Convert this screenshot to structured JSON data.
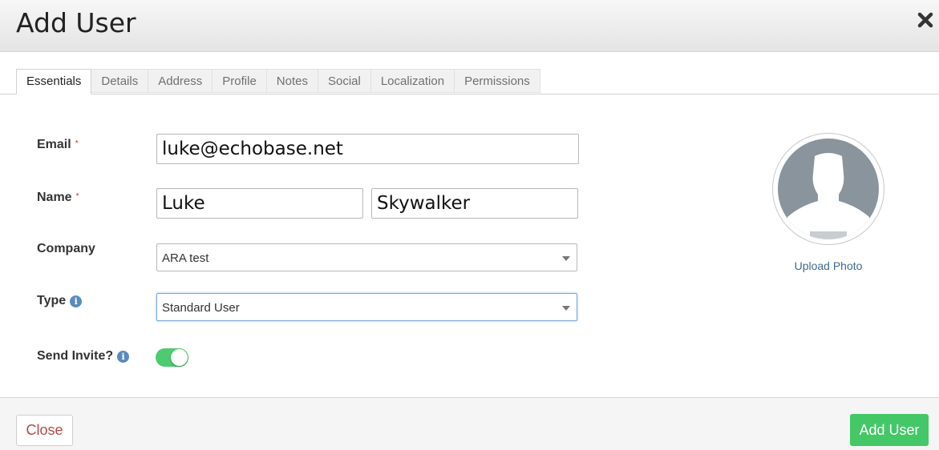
{
  "header": {
    "title": "Add User",
    "close_icon": "close-icon"
  },
  "tabs": [
    {
      "label": "Essentials",
      "active": true
    },
    {
      "label": "Details"
    },
    {
      "label": "Address"
    },
    {
      "label": "Profile"
    },
    {
      "label": "Notes"
    },
    {
      "label": "Social"
    },
    {
      "label": "Localization"
    },
    {
      "label": "Permissions"
    }
  ],
  "form": {
    "email": {
      "label": "Email",
      "required_mark": "*",
      "value": "luke@echobase.net"
    },
    "name": {
      "label": "Name",
      "required_mark": "*",
      "first": "Luke",
      "last": "Skywalker"
    },
    "company": {
      "label": "Company",
      "value": "ARA test"
    },
    "type": {
      "label": "Type",
      "info_icon": "info-icon",
      "value": "Standard User"
    },
    "invite": {
      "label": "Send Invite?",
      "info_icon": "info-icon",
      "on": true
    }
  },
  "photo": {
    "icon": "user-silhouette-icon",
    "upload_label": "Upload Photo"
  },
  "footer": {
    "close_label": "Close",
    "add_label": "Add User"
  },
  "colors": {
    "primary": "#44c767",
    "toggle_on": "#4ccc6e",
    "link": "#3d6a91",
    "required": "#c9302c",
    "close_text": "#b24a4a"
  }
}
